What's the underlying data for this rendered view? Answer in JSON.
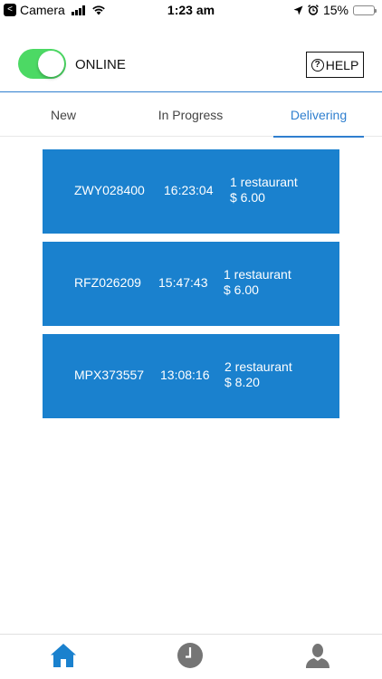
{
  "status_bar": {
    "back_glyph": "<",
    "carrier": "Camera",
    "time": "1:23 am",
    "battery": "15%",
    "battery_level": 0.15
  },
  "header": {
    "online_toggle_on": true,
    "online_label": "ONLINE",
    "help_icon_glyph": "?",
    "help_label": "HELP"
  },
  "tabs": [
    {
      "label": "New",
      "active": false
    },
    {
      "label": "In Progress",
      "active": false
    },
    {
      "label": "Delivering",
      "active": true
    }
  ],
  "orders": [
    {
      "code": "ZWY028400",
      "time": "16:23:04",
      "restaurants": "1 restaurant",
      "amount": "$ 6.00"
    },
    {
      "code": "RFZ026209",
      "time": "15:47:43",
      "restaurants": "1 restaurant",
      "amount": "$ 6.00"
    },
    {
      "code": "MPX373557",
      "time": "13:08:16",
      "restaurants": "2 restaurant",
      "amount": "$ 8.20"
    }
  ],
  "bottom_nav": [
    {
      "icon": "home-icon",
      "active": true
    },
    {
      "icon": "clock-icon",
      "active": false
    },
    {
      "icon": "person-icon",
      "active": false
    }
  ],
  "colors": {
    "accent": "#1a81ce",
    "tab_active": "#2f7fcf",
    "toggle_on": "#4cd964",
    "battery_low": "#e0302a",
    "nav_inactive": "#757575"
  }
}
